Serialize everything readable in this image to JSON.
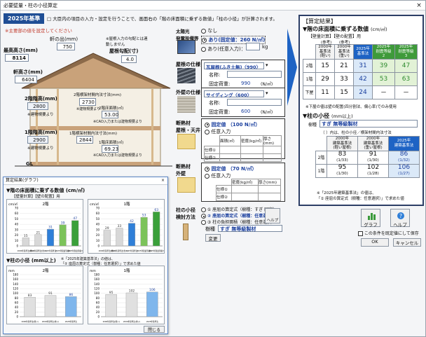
{
  "window": {
    "title": "必要壁量・柱の小径算定",
    "close": "×"
  },
  "header": {
    "badge": "2025年基準",
    "icon": "□",
    "description": "大臣内の項目の入力・設定を行うことで、画面右の「階の床面積に乗ずる数値」「柱の小径」が計算されます。",
    "note": "※主要部の値を設定してください"
  },
  "building": {
    "noki_label": "軒の出(mm)",
    "noki_value": "750",
    "top_label": "最高高さ(mm)",
    "top_value": "8114",
    "yane_label": "屋根勾配(寸)",
    "yane_value": "4.0",
    "yane_note": "※屋根入力の勾配とは連動しません",
    "nokitaka_label": "軒高さ(mm)",
    "nokitaka_value": "6404",
    "f2_label": "2階階高(mm)",
    "f2_value": "2800",
    "f2_note": "※建物規要より",
    "f1_label": "1階階高(mm)",
    "f1_value": "2900",
    "f1_note": "※建物規要より",
    "gl": "GL",
    "f2_wall_label": "2階横架材間内法寸法(mm)",
    "f2_wall_value": "2730",
    "f2_wall_note": "※建物規要より",
    "f2_area_label": "2階床面積(㎡)",
    "f2_area_value": "53.00",
    "f2_area_note": "※CAD入力または建物規要より",
    "f1_wall_label": "1階横架材間内法寸法(mm)",
    "f1_wall_value": "2844",
    "f1_area_label": "1階床面積(㎡)",
    "f1_area_value": "69.23",
    "f1_area_note": "※CAD入力または建物規要より"
  },
  "solar": {
    "title": "太陽光\n発電設備等",
    "opt_none": "なし",
    "opt_fixed": "あり(固定値：260 N/㎡)",
    "opt_any": "あり(任意入力)：",
    "unit": "kg"
  },
  "roof": {
    "title": "屋根の仕様",
    "select": "瓦屋根(ふき土無)〈990〉",
    "name_label": "名称:",
    "load_label": "固定荷重:",
    "load_value": "990",
    "load_unit": "(N/㎡)"
  },
  "wall": {
    "title": "外壁の仕様",
    "select": "サイディング〈600〉",
    "name_label": "名称:",
    "load_label": "固定荷重:",
    "load_value": "600",
    "load_unit": "(N/㎡)"
  },
  "ins_roof": {
    "title": "断熱材\n屋根・天井",
    "opt_fixed": "固定値 （100 N/㎡）",
    "opt_any": "任意入力",
    "col1": "面積(㎡)",
    "col2": "密度(kg/㎥)",
    "col3": "厚さ(mm)",
    "row1": "仕様①",
    "row2": "仕様②"
  },
  "ins_wall": {
    "title": "断熱材\n外壁",
    "opt_fixed": "固定値 （70 N/㎡）",
    "opt_any": "任意入力",
    "col1": "密度(kg/㎥)",
    "col2": "厚さ(mm)",
    "row1": "仕様①",
    "row2": "仕様②"
  },
  "column": {
    "title": "柱の小径\n検討方法",
    "opt1": "① 座屈の算定式（樹種：すぎ 固定）",
    "opt2": "② 座屈の算定式（樹種：任意選択）",
    "opt3": "③ 柱の負担面積（樹種：任意選択）",
    "species_label": "樹種",
    "species_value": "すぎ 無等級製材",
    "change": "変更",
    "help": "ヘルプ"
  },
  "result": {
    "title": "【算定結果】",
    "floor_title": "▼階の床面積に乗ずる数値",
    "floor_unit": "(cm/㎡)",
    "floor_sub": "【壁量計算】【壁の配置】用",
    "ref": "(参考)",
    "heads": [
      "2000年\n基準法\n(軽い)",
      "2000年\n基準法\n(重い)",
      "2025年\n基準法",
      "2025年\n耐震等級\n2",
      "2025年\n耐震等級\n3"
    ],
    "rows": [
      {
        "label": "2階",
        "values": [
          "15",
          "21",
          "31",
          "39",
          "47"
        ]
      },
      {
        "label": "1階",
        "values": [
          "29",
          "33",
          "42",
          "53",
          "63"
        ]
      },
      {
        "label": "下屋",
        "values": [
          "11",
          "15",
          "24",
          "－",
          "－"
        ]
      }
    ],
    "floor_note": "※下屋の値は壁の配置(四分割法、偏心率)でのみ使用",
    "col_title": "▼柱の小径",
    "col_unit": "(mm以上)",
    "species_label": "樹種",
    "species_value": "すぎ 無等級製材",
    "col_note": "（ ）内は、柱の小径／横架材間内法寸法",
    "col_heads": [
      "2000年\n建築基準法\n(軽い屋根)",
      "2000年\n建築基準法\n(重い屋根)",
      "2025年\n建築基準法"
    ],
    "col_rows": [
      {
        "label": "2階",
        "values": [
          "83",
          "91",
          "86"
        ],
        "ratios": [
          "(1/33)",
          "(1/30)",
          "(1/32)"
        ]
      },
      {
        "label": "1階",
        "values": [
          "95",
          "102",
          "106"
        ],
        "ratios": [
          "(1/30)",
          "(1/28)",
          "(1/27)"
        ]
      }
    ],
    "col_note2": "※「2025年建築基準法」の値は、\n「② 座屈の算定式（樹種：任意選択）」で求めた値"
  },
  "buttons": {
    "graph": "グラフ",
    "help": "ヘルプ",
    "save": "この条件を既定値にして保存",
    "ok": "OK",
    "cancel": "キャンセル"
  },
  "subwin": {
    "title": "算定結果(グラフ)",
    "floor_title": "▼階の床面積に乗ずる数値 (cm/㎡)",
    "floor_sub": "【壁量計算】【壁の配置】用",
    "col_title": "▼柱の小径 (mm以上)",
    "col_note": "※「2025年建築基準法」の値は、\n「② 座屈の算定式（樹種：任意選択）」で求めた値",
    "close": "閉じる",
    "ylabel1": "cm/㎡",
    "ylabel2": "mm"
  },
  "chart_data": [
    {
      "type": "bar",
      "title": "2階",
      "categories": [
        "2000年基準法(軽い)",
        "2000年基準法(重い)",
        "2025年基準法",
        "2025年耐震等級2",
        "2025年耐震等級3"
      ],
      "values": [
        15,
        21,
        31,
        39,
        47
      ],
      "ylim": [
        0,
        70
      ],
      "colors": [
        "#d8d8d8",
        "#d8d8d8",
        "#2f7fd8",
        "#7cc35a",
        "#3aa03a"
      ]
    },
    {
      "type": "bar",
      "title": "1階",
      "categories": [
        "2000年基準法(軽い)",
        "2000年基準法(重い)",
        "2025年基準法",
        "2025年耐震等級2",
        "2025年耐震等級3"
      ],
      "values": [
        29,
        33,
        42,
        53,
        63
      ],
      "ylim": [
        0,
        70
      ],
      "colors": [
        "#d8d8d8",
        "#d8d8d8",
        "#2f7fd8",
        "#7cc35a",
        "#3aa03a"
      ]
    },
    {
      "type": "bar",
      "title": "2階",
      "categories": [
        "2000年基準法(軽い)",
        "2000年基準法(重い)",
        "2025年基準法"
      ],
      "values": [
        83,
        91,
        86
      ],
      "ylim": [
        0,
        180
      ],
      "colors": [
        "#e0e0e0",
        "#e0e0e0",
        "#7fb6ec"
      ]
    },
    {
      "type": "bar",
      "title": "1階",
      "categories": [
        "2000年基準法(軽い)",
        "2000年基準法(重い)",
        "2025年基準法"
      ],
      "values": [
        95,
        102,
        106
      ],
      "ylim": [
        0,
        180
      ],
      "colors": [
        "#e0e0e0",
        "#e0e0e0",
        "#7fb6ec"
      ]
    }
  ]
}
